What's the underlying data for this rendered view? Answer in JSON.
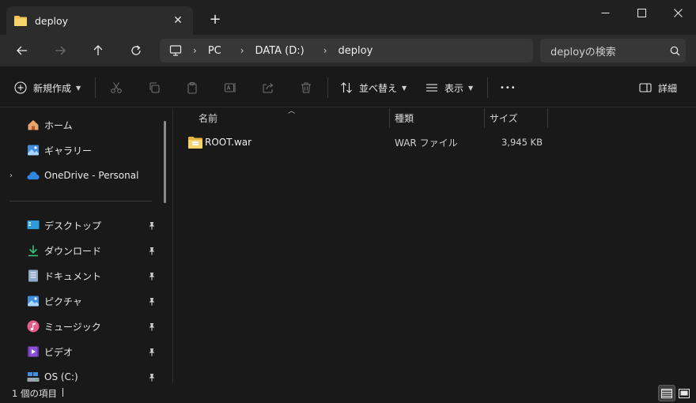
{
  "tab": {
    "title": "deploy",
    "close_glyph": "✕",
    "new_glyph": "+"
  },
  "window_controls": {
    "minimize": "minimize-icon",
    "maximize": "maximize-icon",
    "close": "close-icon"
  },
  "address": {
    "crumbs": [
      "PC",
      "DATA (D:)",
      "deploy"
    ],
    "separator": "›",
    "search_placeholder": "deployの検索"
  },
  "commandbar": {
    "new_label": "新規作成",
    "sort_label": "並べ替え",
    "view_label": "表示",
    "more_label": "•••",
    "details_label": "詳細"
  },
  "sidebar": {
    "top_items": [
      {
        "label": "ホーム",
        "icon": "home-icon"
      },
      {
        "label": "ギャラリー",
        "icon": "gallery-icon"
      },
      {
        "label": "OneDrive - Personal",
        "icon": "cloud-icon",
        "expander": "›"
      }
    ],
    "pinned_items": [
      {
        "label": "デスクトップ",
        "icon": "desktop-icon"
      },
      {
        "label": "ダウンロード",
        "icon": "download-icon"
      },
      {
        "label": "ドキュメント",
        "icon": "document-icon"
      },
      {
        "label": "ピクチャ",
        "icon": "pictures-icon"
      },
      {
        "label": "ミュージック",
        "icon": "music-icon"
      },
      {
        "label": "ビデオ",
        "icon": "video-icon"
      },
      {
        "label": "OS (C:)",
        "icon": "drive-icon"
      }
    ]
  },
  "columns": {
    "name": "名前",
    "type": "種類",
    "size": "サイズ"
  },
  "files": [
    {
      "name": "ROOT.war",
      "type": "WAR ファイル",
      "size": "3,945 KB",
      "icon": "zip-folder-icon"
    }
  ],
  "status": {
    "count_text": "1 個の項目"
  },
  "colors": {
    "background": "#191919",
    "titlebar": "#202020",
    "tab": "#2c2c2c",
    "folder": "#f0c350"
  }
}
